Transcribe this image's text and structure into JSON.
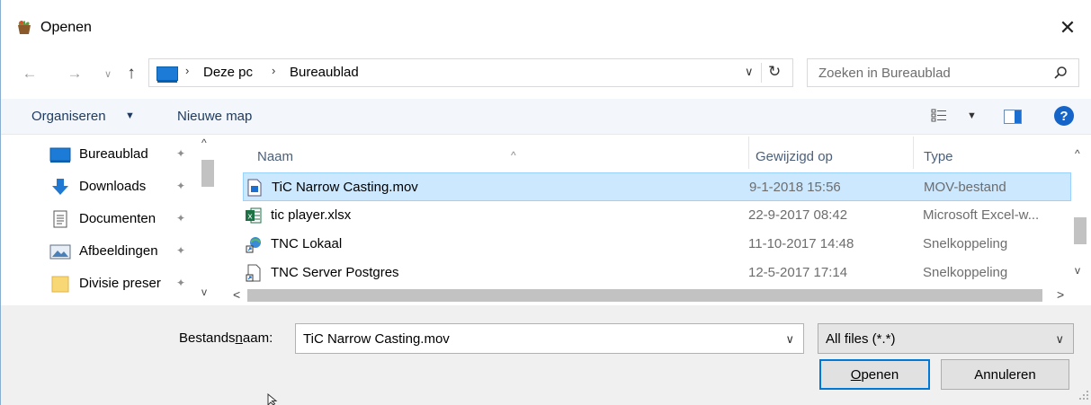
{
  "window": {
    "title": "Openen",
    "close_symbol": "✕",
    "app_icon": "app-icon"
  },
  "address": {
    "back": "←",
    "forward": "→",
    "recent": "∨",
    "up": "↑",
    "separator": "›",
    "crumbs": [
      "Deze pc",
      "Bureaublad"
    ],
    "dropdown": "∨",
    "refresh": "↻",
    "search_placeholder": "Zoeken in Bureaublad"
  },
  "toolbar": {
    "organise_label": "Organiseren",
    "dropdown_arrow": "▼",
    "new_folder_label": "Nieuwe map",
    "help_symbol": "?"
  },
  "navpane": {
    "pin_symbol": "📌",
    "scroll_up": "^",
    "scroll_down": "v",
    "items": [
      {
        "label": "Bureaublad",
        "icon": "desktop-icon"
      },
      {
        "label": "Downloads",
        "icon": "download-icon"
      },
      {
        "label": "Documenten",
        "icon": "documents-icon"
      },
      {
        "label": "Afbeeldingen",
        "icon": "pictures-icon"
      },
      {
        "label": "Divisie preser",
        "icon": "folder-icon"
      }
    ]
  },
  "filelist": {
    "columns": {
      "name": "Naam",
      "modified": "Gewijzigd op",
      "type": "Type"
    },
    "sort_indicator": "^",
    "rows": [
      {
        "name": "TiC Narrow Casting.mov",
        "date": "9-1-2018 15:56",
        "type": "MOV-bestand",
        "icon": "video-file-icon",
        "selected": true
      },
      {
        "name": "tic player.xlsx",
        "date": "22-9-2017 08:42",
        "type": "Microsoft Excel-w...",
        "icon": "excel-file-icon",
        "selected": false
      },
      {
        "name": "TNC Lokaal",
        "date": "11-10-2017 14:48",
        "type": "Snelkoppeling",
        "icon": "shortcut-icon",
        "selected": false
      },
      {
        "name": "TNC Server Postgres",
        "date": "12-5-2017 17:14",
        "type": "Snelkoppeling",
        "icon": "shortcut-file-icon",
        "selected": false
      }
    ],
    "vscroll_up": "^",
    "vscroll_down": "v",
    "hscroll_left": "<",
    "hscroll_right": ">"
  },
  "footer": {
    "filename_label_pre": "Bestands",
    "filename_label_ul": "n",
    "filename_label_post": "aam:",
    "filename_value": "TiC Narrow Casting.mov",
    "filename_arrow": "∨",
    "filter_value": "All files (*.*)",
    "filter_arrow": "∨",
    "open_label_ul": "O",
    "open_label_rest": "penen",
    "cancel_label": "Annuleren"
  }
}
